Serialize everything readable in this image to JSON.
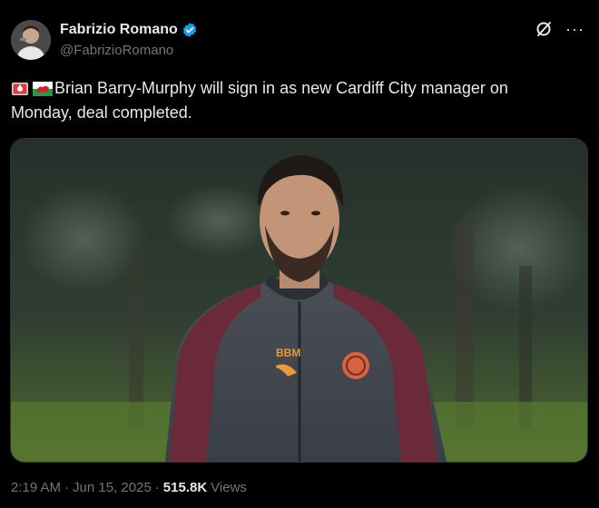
{
  "author": {
    "display_name": "Fabrizio Romano",
    "handle": "@FabrizioRomano",
    "verified": true
  },
  "tweet": {
    "text": "Brian Barry-Murphy will sign in as new Cardiff City manager on Monday, deal completed.",
    "emojis": [
      "rotating-light-emoji",
      "wales-flag-emoji"
    ]
  },
  "meta": {
    "time": "2:19 AM",
    "separator": "·",
    "date": "Jun 15, 2025",
    "views_count": "515.8K",
    "views_label": "Views"
  },
  "photo": {
    "description_icon": "photo-man-in-training-top",
    "badge_text": "BBM"
  },
  "colors": {
    "background": "#000000",
    "text": "#e7e9ea",
    "muted": "#71767b",
    "verified": "#1d9bf0"
  }
}
